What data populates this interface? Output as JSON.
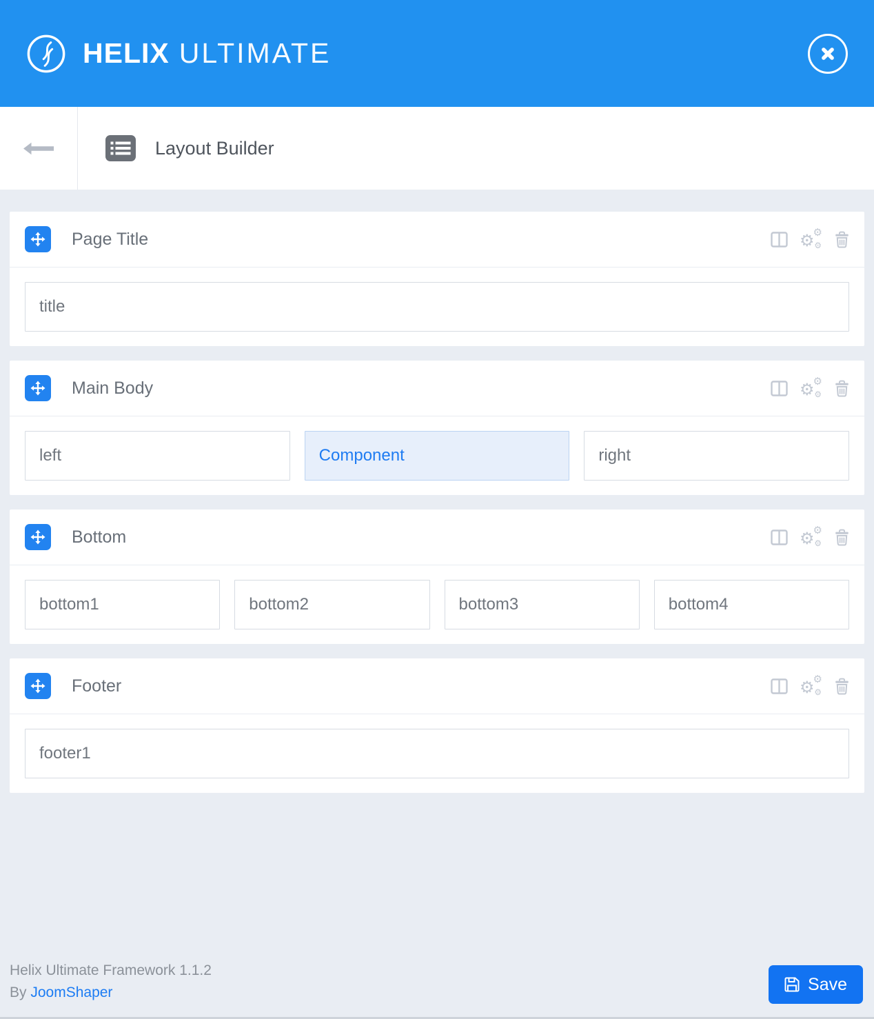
{
  "colors": {
    "header_blue": "#2191f0",
    "accent_blue": "#1f7cf2",
    "save_blue": "#1273f2",
    "background": "#e9edf3",
    "component_bg": "#e7effb",
    "component_border": "#bad3f2",
    "icon_gray": "#c3c9d3"
  },
  "header": {
    "brand_bold": "HELIX",
    "brand_light": "ULTIMATE"
  },
  "toolbar": {
    "title": "Layout Builder"
  },
  "sections": [
    {
      "title": "Page Title",
      "boxes": [
        {
          "label": "title"
        }
      ]
    },
    {
      "title": "Main Body",
      "boxes": [
        {
          "label": "left"
        },
        {
          "label": "Component"
        },
        {
          "label": "right"
        }
      ]
    },
    {
      "title": "Bottom",
      "boxes": [
        {
          "label": "bottom1"
        },
        {
          "label": "bottom2"
        },
        {
          "label": "bottom3"
        },
        {
          "label": "bottom4"
        }
      ]
    },
    {
      "title": "Footer",
      "boxes": [
        {
          "label": "footer1"
        }
      ]
    }
  ],
  "footer": {
    "framework": "Helix Ultimate Framework 1.1.2",
    "by_prefix": "By",
    "by_link": "JoomShaper",
    "save_label": "Save"
  },
  "icons": {
    "logo": "helix-logo",
    "close": "close-circle-icon",
    "back": "back-arrow-icon",
    "toolbar": "list-panel-icon",
    "drag_handle": "move-icon",
    "section_actions": [
      "columns-icon",
      "cogs-icon",
      "trash-icon"
    ],
    "save": "floppy-disk-icon",
    "cog_glyph": "⚙"
  }
}
